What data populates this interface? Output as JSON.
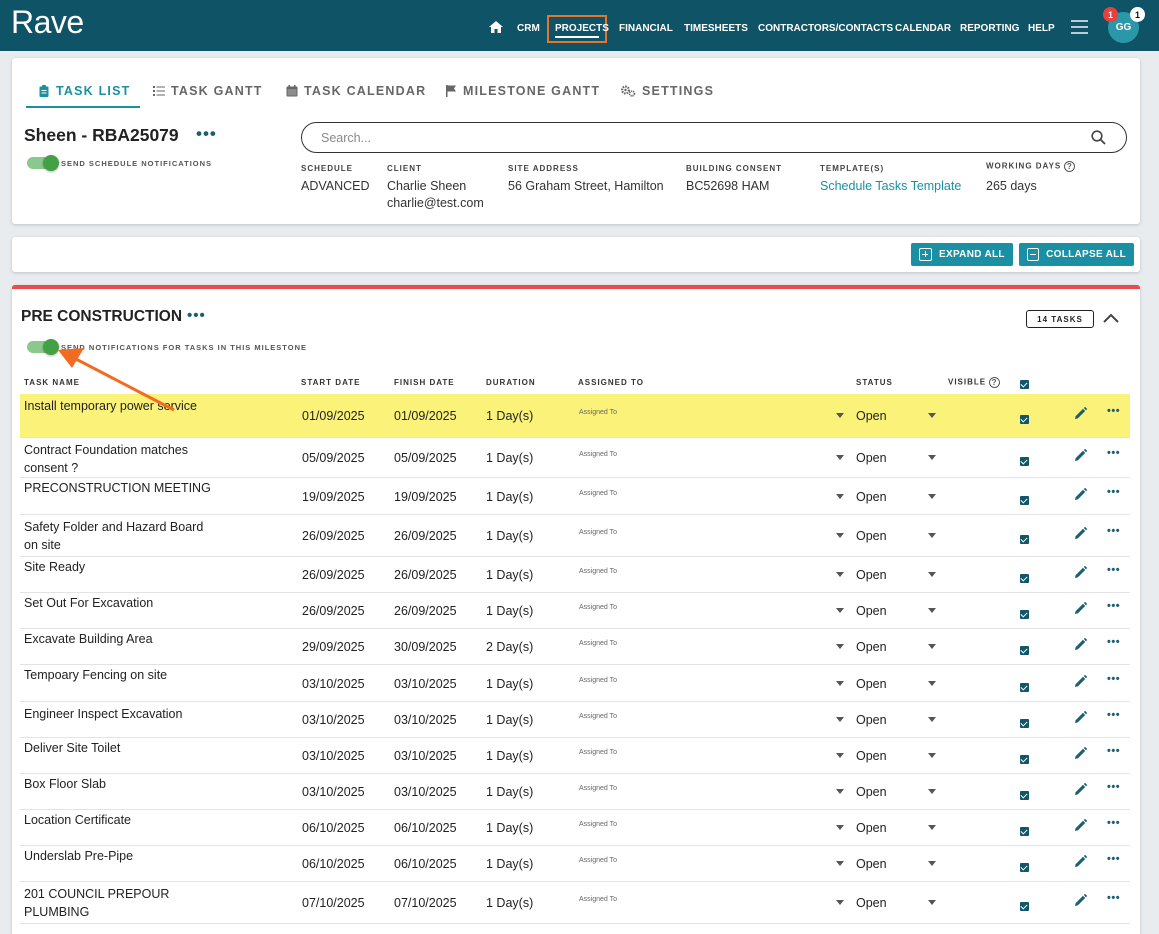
{
  "app": {
    "logo": "Rave"
  },
  "nav": {
    "items": [
      "CRM",
      "PROJECTS",
      "FINANCIAL",
      "TIMESHEETS",
      "CONTRACTORS/CONTACTS",
      "CALENDAR",
      "REPORTING",
      "HELP"
    ],
    "active": "PROJECTS",
    "avatar_initials": "GG",
    "notification_count": "1",
    "message_count": "1"
  },
  "tabs": [
    "TASK LIST",
    "TASK GANTT",
    "TASK CALENDAR",
    "MILESTONE GANTT",
    "SETTINGS"
  ],
  "project": {
    "title": "Sheen - RBA25079",
    "more": "•••",
    "notify_label": "SEND SCHEDULE NOTIFICATIONS",
    "notify_on": true
  },
  "search": {
    "placeholder": "Search..."
  },
  "meta": {
    "schedule": {
      "label": "SCHEDULE",
      "value": "ADVANCED"
    },
    "client": {
      "label": "CLIENT",
      "name": "Charlie Sheen",
      "email": "charlie@test.com"
    },
    "site_address": {
      "label": "SITE ADDRESS",
      "value": "56 Graham Street, Hamilton"
    },
    "building_consent": {
      "label": "BUILDING CONSENT",
      "value": "BC52698 HAM"
    },
    "templates": {
      "label": "TEMPLATE(S)",
      "value": "Schedule Tasks Template"
    },
    "working_days": {
      "label": "WORKING DAYS",
      "value": "265 days",
      "help": "?"
    }
  },
  "actions": {
    "expand_all": "EXPAND ALL",
    "collapse_all": "COLLAPSE ALL"
  },
  "milestone": {
    "title": "PRE CONSTRUCTION",
    "more": "•••",
    "task_count": "14 TASKS",
    "notify_label": "SEND NOTIFICATIONS FOR TASKS IN THIS MILESTONE",
    "notify_on": true
  },
  "table": {
    "headers": {
      "task_name": "TASK NAME",
      "start_date": "START DATE",
      "finish_date": "FINISH DATE",
      "duration": "DURATION",
      "assigned_to": "ASSIGNED TO",
      "status": "STATUS",
      "visible": "VISIBLE",
      "visible_help": "?"
    },
    "rows": [
      {
        "task": "Install temporary power service",
        "start": "01/09/2025",
        "finish": "01/09/2025",
        "duration": "1 Day(s)",
        "assigned": "Assigned To",
        "status": "Open",
        "highlighted": true
      },
      {
        "task": "Contract Foundation matches consent ?",
        "start": "05/09/2025",
        "finish": "05/09/2025",
        "duration": "1 Day(s)",
        "assigned": "Assigned To",
        "status": "Open"
      },
      {
        "task": "PRECONSTRUCTION MEETING",
        "start": "19/09/2025",
        "finish": "19/09/2025",
        "duration": "1 Day(s)",
        "assigned": "Assigned To",
        "status": "Open"
      },
      {
        "task": "Safety Folder and Hazard Board on site",
        "start": "26/09/2025",
        "finish": "26/09/2025",
        "duration": "1 Day(s)",
        "assigned": "Assigned To",
        "status": "Open"
      },
      {
        "task": "Site Ready",
        "start": "26/09/2025",
        "finish": "26/09/2025",
        "duration": "1 Day(s)",
        "assigned": "Assigned To",
        "status": "Open"
      },
      {
        "task": "Set Out For Excavation",
        "start": "26/09/2025",
        "finish": "26/09/2025",
        "duration": "1 Day(s)",
        "assigned": "Assigned To",
        "status": "Open"
      },
      {
        "task": "Excavate Building Area",
        "start": "29/09/2025",
        "finish": "30/09/2025",
        "duration": "2 Day(s)",
        "assigned": "Assigned To",
        "status": "Open"
      },
      {
        "task": "Tempoary Fencing on site",
        "start": "03/10/2025",
        "finish": "03/10/2025",
        "duration": "1 Day(s)",
        "assigned": "Assigned To",
        "status": "Open"
      },
      {
        "task": "Engineer Inspect Excavation",
        "start": "03/10/2025",
        "finish": "03/10/2025",
        "duration": "1 Day(s)",
        "assigned": "Assigned To",
        "status": "Open"
      },
      {
        "task": "Deliver Site Toilet",
        "start": "03/10/2025",
        "finish": "03/10/2025",
        "duration": "1 Day(s)",
        "assigned": "Assigned To",
        "status": "Open"
      },
      {
        "task": "Box Floor Slab",
        "start": "03/10/2025",
        "finish": "03/10/2025",
        "duration": "1 Day(s)",
        "assigned": "Assigned To",
        "status": "Open"
      },
      {
        "task": "Location Certificate",
        "start": "06/10/2025",
        "finish": "06/10/2025",
        "duration": "1 Day(s)",
        "assigned": "Assigned To",
        "status": "Open"
      },
      {
        "task": "Underslab Pre-Pipe",
        "start": "06/10/2025",
        "finish": "06/10/2025",
        "duration": "1 Day(s)",
        "assigned": "Assigned To",
        "status": "Open"
      },
      {
        "task": "201 COUNCIL PREPOUR PLUMBING",
        "start": "07/10/2025",
        "finish": "07/10/2025",
        "duration": "1 Day(s)",
        "assigned": "Assigned To",
        "status": "Open"
      }
    ],
    "row_more": "•••"
  },
  "colors": {
    "topbar": "#0f5366",
    "accent": "#1b8fa3",
    "milestone_bar": "#e84c4c",
    "highlight": "#fbf27a",
    "annotation_box": "#e8752d",
    "toggle_on": "#43a047"
  }
}
